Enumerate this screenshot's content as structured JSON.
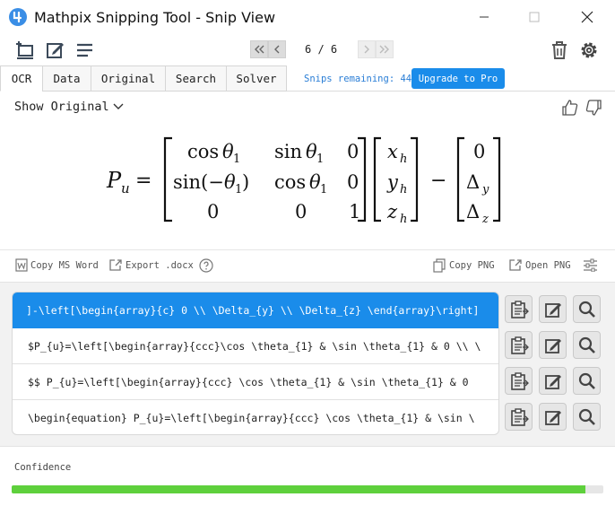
{
  "window": {
    "title": "Mathpix Snipping Tool - Snip View",
    "app_icon": "mathpix-logo-icon",
    "controls": [
      "minimize-icon",
      "maximize-icon",
      "close-icon"
    ]
  },
  "toolbar": {
    "left_icons": [
      "new-snip-icon",
      "edit-icon",
      "menu-icon"
    ],
    "pagination": {
      "current": 6,
      "total": 6,
      "label": "6 / 6"
    },
    "right_icons": [
      "trash-icon",
      "gear-icon"
    ]
  },
  "tabs": [
    {
      "label": "OCR",
      "active": true
    },
    {
      "label": "Data",
      "active": false
    },
    {
      "label": "Original",
      "active": false
    },
    {
      "label": "Search",
      "active": false
    },
    {
      "label": "Solver",
      "active": false
    }
  ],
  "snips_remaining": "Snips remaining: 44",
  "upgrade_label": "Upgrade to Pro",
  "show_original_label": "Show Original",
  "feedback_icons": [
    "thumbs-up-icon",
    "thumbs-down-icon"
  ],
  "equation": {
    "lhs": "P",
    "lhs_sub": "u",
    "matrix": [
      [
        "cos θ1",
        "sin θ1",
        "0"
      ],
      [
        "sin(−θ1)",
        "cos θ1",
        "0"
      ],
      [
        "0",
        "0",
        "1"
      ]
    ],
    "vector": [
      "x_h",
      "y_h",
      "z_h"
    ],
    "offset": [
      "0",
      "Δ_y",
      "Δ_z"
    ]
  },
  "actions": {
    "copy_word": "Copy MS Word",
    "export_docx": "Export .docx",
    "copy_png": "Copy PNG",
    "open_png": "Open PNG"
  },
  "results": [
    {
      "text": "]-\\left[\\begin{array}{c} 0 \\\\ \\Delta_{y} \\\\ \\Delta_{z} \\end{array}\\right]",
      "selected": true
    },
    {
      "text": "$P_{u}=\\left[\\begin{array}{ccc}\\cos \\theta_{1} & \\sin \\theta_{1} & 0 \\\\ \\",
      "selected": false
    },
    {
      "text": "$$  P_{u}=\\left[\\begin{array}{ccc} \\cos \\theta_{1} & \\sin \\theta_{1} & 0",
      "selected": false
    },
    {
      "text": "\\begin{equation}  P_{u}=\\left[\\begin{array}{ccc} \\cos \\theta_{1} & \\sin \\",
      "selected": false
    }
  ],
  "confidence": {
    "label": "Confidence",
    "value": 0.97
  },
  "colors": {
    "accent": "#1a8cea",
    "link": "#2a7ed6",
    "confidence_fill": "#5ed03c"
  }
}
